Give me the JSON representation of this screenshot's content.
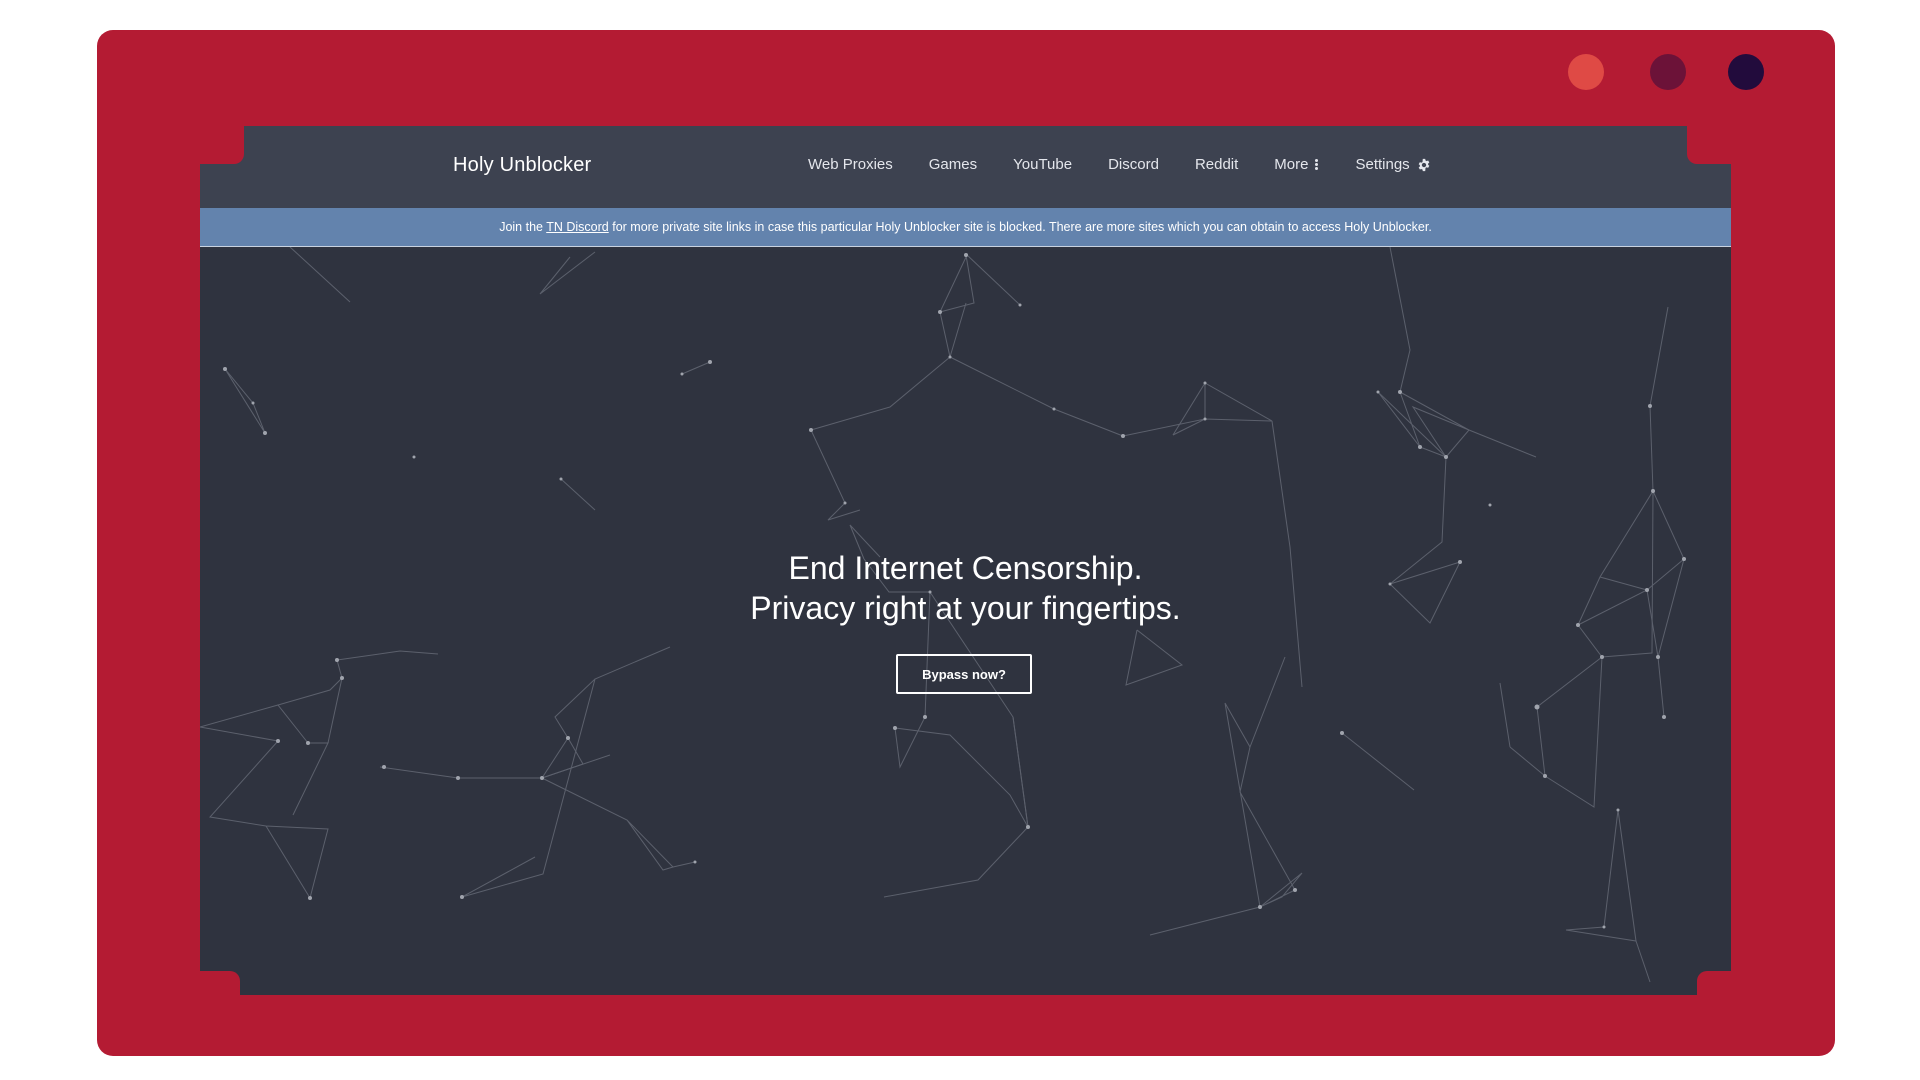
{
  "window": {
    "controls": [
      "close",
      "minimize",
      "maximize"
    ],
    "colors": {
      "frame": "#b41b33",
      "close": "#df4a45",
      "minimize": "#6c1238",
      "maximize": "#220b3c"
    }
  },
  "navbar": {
    "brand": "Holy Unblocker",
    "links": [
      {
        "label": "Web Proxies"
      },
      {
        "label": "Games"
      },
      {
        "label": "YouTube"
      },
      {
        "label": "Discord"
      },
      {
        "label": "Reddit"
      },
      {
        "label": "More",
        "icon": "vertical-ellipsis-icon"
      },
      {
        "label": "Settings",
        "icon": "gear-icon"
      }
    ]
  },
  "banner": {
    "prefix": "Join the",
    "link": "TN Discord",
    "suffix": "for more private site links in case this particular Holy Unblocker site is blocked. There are more sites which you can obtain to access Holy Unblocker."
  },
  "hero": {
    "line1": "End Internet Censorship.",
    "line2": "Privacy right at your fingertips.",
    "button": "Bypass now?"
  },
  "colors": {
    "navbar": "#3d4250",
    "banner": "#6383ad",
    "background": "#2f333f"
  }
}
